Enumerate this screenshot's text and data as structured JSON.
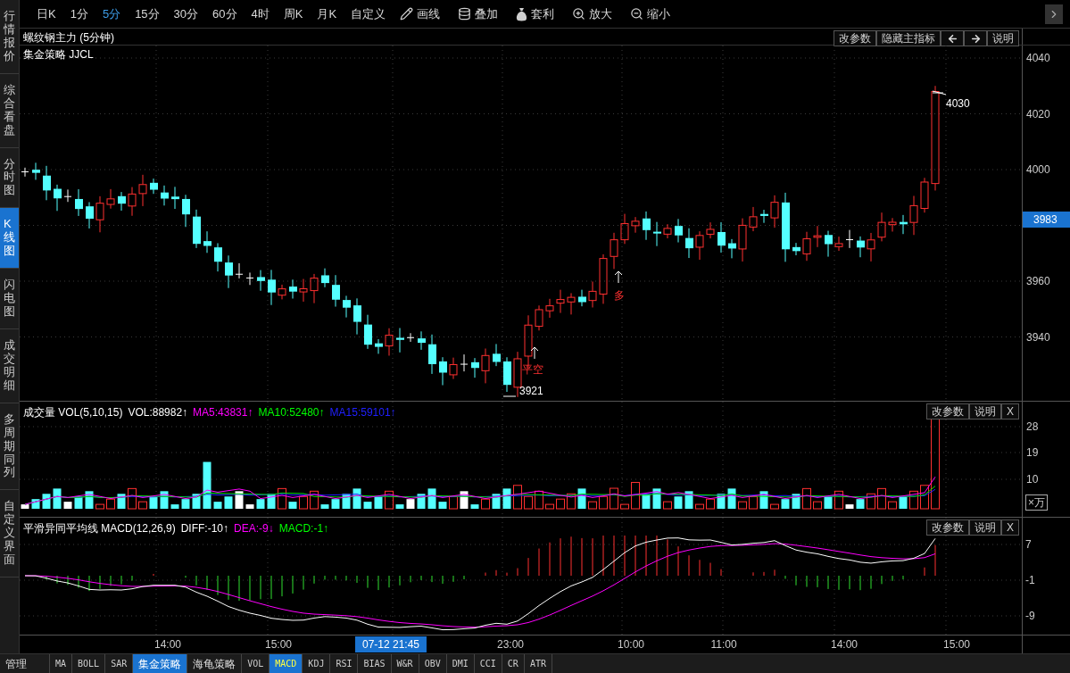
{
  "sidebar": {
    "tabs": [
      {
        "label": "行情报价",
        "selected": false
      },
      {
        "label": "综合看盘",
        "selected": false
      },
      {
        "label": "分时图",
        "selected": false
      },
      {
        "label": "K线图",
        "selected": true
      },
      {
        "label": "闪电图",
        "selected": false
      },
      {
        "label": "成交明细",
        "selected": false
      },
      {
        "label": "多周期同列",
        "selected": false
      },
      {
        "label": "自定义界面",
        "selected": false
      }
    ]
  },
  "toolbar": {
    "periods": [
      {
        "label": "日K",
        "selected": false
      },
      {
        "label": "1分",
        "selected": false
      },
      {
        "label": "5分",
        "selected": true
      },
      {
        "label": "15分",
        "selected": false
      },
      {
        "label": "30分",
        "selected": false
      },
      {
        "label": "60分",
        "selected": false
      },
      {
        "label": "4时",
        "selected": false
      },
      {
        "label": "周K",
        "selected": false
      },
      {
        "label": "月K",
        "selected": false
      },
      {
        "label": "自定义",
        "selected": false
      }
    ],
    "tools": [
      {
        "kind": "pencil",
        "label": "画线"
      },
      {
        "kind": "stack",
        "label": "叠加"
      },
      {
        "kind": "bag",
        "label": "套利"
      },
      {
        "kind": "zoom-in",
        "label": "放大"
      },
      {
        "kind": "zoom-out",
        "label": "缩小"
      }
    ]
  },
  "main_chart": {
    "title": "螺纹钢主力 (5分钟)",
    "buttons": [
      {
        "kind": "text",
        "label": "改参数"
      },
      {
        "kind": "text",
        "label": "隐藏主指标"
      },
      {
        "kind": "arrow-left"
      },
      {
        "kind": "arrow-right"
      },
      {
        "kind": "text",
        "label": "说明"
      }
    ],
    "indicator": "集金策略 JJCL",
    "yaxis": [
      "4040",
      "4020",
      "4000",
      "3960",
      "3940"
    ],
    "price_tag": "3983",
    "annotations": [
      {
        "kind": "high",
        "label": "4030"
      },
      {
        "kind": "low",
        "label": "3921"
      },
      {
        "kind": "signal",
        "label": "平空"
      },
      {
        "kind": "signal",
        "label": "多"
      }
    ]
  },
  "volume": {
    "legend": [
      {
        "text": "成交量 VOL(5,10,15)",
        "color": "#ffffff"
      },
      {
        "text": "VOL:88982↑",
        "color": "#ffffff"
      },
      {
        "text": "MA5:43831↑",
        "color": "#ff00ff"
      },
      {
        "text": "MA10:52480↑",
        "color": "#00ff00"
      },
      {
        "text": "MA15:59101↑",
        "color": "#2020ff"
      }
    ],
    "buttons": [
      "改参数",
      "说明",
      "X"
    ],
    "yaxis": [
      "28",
      "19",
      "10"
    ],
    "unit": "×万"
  },
  "macd": {
    "legend": [
      {
        "text": "平滑异同平均线 MACD(12,26,9)",
        "color": "#ffffff"
      },
      {
        "text": "DIFF:-10↑",
        "color": "#ffffff"
      },
      {
        "text": "DEA:-9↓",
        "color": "#ff00ff"
      },
      {
        "text": "MACD:-1↑",
        "color": "#00ff00"
      }
    ],
    "buttons": [
      "改参数",
      "说明",
      "X"
    ],
    "yaxis": [
      "7",
      "-1",
      "-9"
    ]
  },
  "time_axis": [
    {
      "label": "14:00",
      "selected": false
    },
    {
      "label": "15:00",
      "selected": false
    },
    {
      "label": "07-12 21:45",
      "selected": true
    },
    {
      "label": "23:00",
      "selected": false
    },
    {
      "label": "10:00",
      "selected": false
    },
    {
      "label": "11:00",
      "selected": false
    },
    {
      "label": "14:00",
      "selected": false
    },
    {
      "label": "15:00",
      "selected": false
    }
  ],
  "bottom_tabs": [
    {
      "kind": "button",
      "label": "管理"
    },
    {
      "kind": "indicator",
      "label": "MA",
      "selected": false
    },
    {
      "kind": "indicator",
      "label": "BOLL",
      "selected": false
    },
    {
      "kind": "indicator",
      "label": "SAR",
      "selected": false
    },
    {
      "kind": "strategy",
      "label": "集金策略",
      "selected": true
    },
    {
      "kind": "strategy",
      "label": "海龟策略",
      "selected": false
    },
    {
      "kind": "indicator",
      "label": "VOL",
      "selected": false
    },
    {
      "kind": "indicator",
      "label": "MACD",
      "selected": true
    },
    {
      "kind": "indicator",
      "label": "KDJ",
      "selected": false
    },
    {
      "kind": "indicator",
      "label": "RSI",
      "selected": false
    },
    {
      "kind": "indicator",
      "label": "BIAS",
      "selected": false
    },
    {
      "kind": "indicator",
      "label": "W&R",
      "selected": false
    },
    {
      "kind": "indicator",
      "label": "OBV",
      "selected": false
    },
    {
      "kind": "indicator",
      "label": "DMI",
      "selected": false
    },
    {
      "kind": "indicator",
      "label": "CCI",
      "selected": false
    },
    {
      "kind": "indicator",
      "label": "CR",
      "selected": false
    },
    {
      "kind": "indicator",
      "label": "ATR",
      "selected": false
    }
  ]
}
